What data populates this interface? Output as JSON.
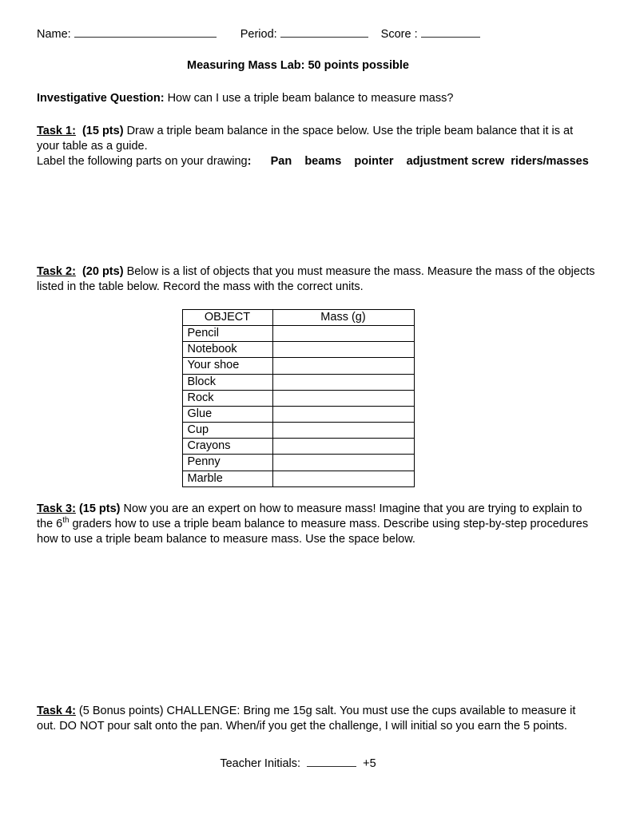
{
  "document": {
    "title": "Measuring Mass Lab:  50 points possible"
  },
  "header": {
    "name_label": "Name:",
    "period_label": "Period:",
    "score_label": "Score :"
  },
  "investigative": {
    "label": "Investigative Question:",
    "text": "  How can I use a triple beam balance to measure mass?"
  },
  "task1": {
    "label": "Task 1:",
    "points": "(15 pts)",
    "text": " Draw a triple beam balance in the space below.  Use the triple beam balance that it is at your table as a guide.",
    "label_line": "Label the following parts on your drawing",
    "label_colon": ":",
    "parts": [
      "Pan",
      "beams",
      "pointer",
      "adjustment screw",
      "riders/masses"
    ]
  },
  "task2": {
    "label": "Task 2:",
    "points": "(20 pts)",
    "text": " Below is a list of objects that you must measure the mass.  Measure the mass of the objects listed in the table below.  Record the mass with the correct units.",
    "table": {
      "columns": [
        "OBJECT",
        "Mass (g)"
      ],
      "rows": [
        [
          "Pencil",
          ""
        ],
        [
          "Notebook",
          ""
        ],
        [
          "Your shoe",
          ""
        ],
        [
          "Block",
          ""
        ],
        [
          "Rock",
          ""
        ],
        [
          "Glue",
          ""
        ],
        [
          "Cup",
          ""
        ],
        [
          "Crayons",
          ""
        ],
        [
          "Penny",
          ""
        ],
        [
          "Marble",
          ""
        ]
      ]
    }
  },
  "task3": {
    "label": "Task 3:",
    "points": "(15 pts)",
    "text_part1": "  Now you are an expert on how to measure mass!  Imagine that you are trying to explain to the 6",
    "superscript": "th",
    "text_part2": " graders how to use a triple beam balance to measure mass.  Describe using step-by-step procedures how to use a triple beam balance to measure mass.  Use the space below."
  },
  "task4": {
    "label": "Task 4:",
    "text": "  (5 Bonus points) CHALLENGE:  Bring me 15g salt.  You must use the cups available to measure it out. DO NOT pour salt onto the pan.  When/if you get the challenge, I will initial so you earn the 5 points."
  },
  "teacher": {
    "label": "Teacher Initials:",
    "bonus": "+5"
  }
}
